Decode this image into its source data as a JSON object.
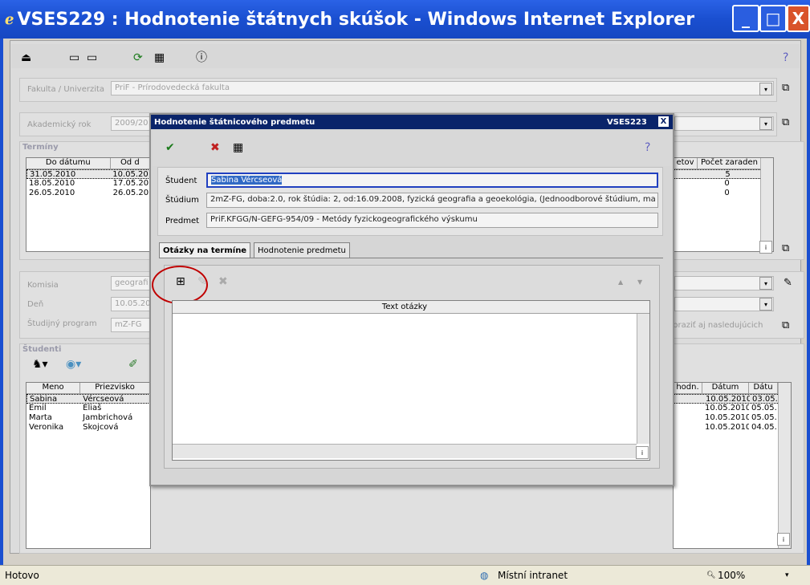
{
  "window": {
    "title": "VSES229 : Hodnotenie štátnych skúšok - Windows Internet Explorer",
    "minimize": "_",
    "maximize": "□",
    "close": "X"
  },
  "main": {
    "faculty_label": "Fakulta / Univerzita",
    "faculty_value": "PriF - Prírodovedecká fakulta",
    "year_label": "Akademický rok",
    "year_value": "2009/20",
    "terms_section": "Termíny",
    "terms_headers": [
      "Do dátumu",
      "Od d"
    ],
    "terms_rows": [
      [
        "31.05.2010",
        "10.05.20"
      ],
      [
        "18.05.2010",
        "17.05.20"
      ],
      [
        "26.05.2010",
        "26.05.20"
      ]
    ],
    "terms_right_headers": [
      "etov",
      "Počet zaraden"
    ],
    "terms_right_values": [
      "5",
      "0",
      "0"
    ],
    "commission_label": "Komisia",
    "commission_value": "geografi",
    "day_label": "Deň",
    "day_value": "10.05.20",
    "program_label": "Študijný program",
    "program_value": "mZ-FG",
    "show_next": "obraziť aj nasledujúcich",
    "students_section": "Študenti",
    "students_headers": [
      "Meno",
      "Priezvisko"
    ],
    "students_rows": [
      [
        "Sabina",
        "Vércseová"
      ],
      [
        "Emil",
        "Eliaš"
      ],
      [
        "Marta",
        "Jambrichová"
      ],
      [
        "Veronika",
        "Škojcová"
      ]
    ],
    "students_right_headers": [
      "hodn.",
      "Dátum",
      "Dátu"
    ],
    "students_right_rows": [
      [
        "10.05.2010",
        "03.05."
      ],
      [
        "10.05.2010",
        "05.05."
      ],
      [
        "10.05.2010",
        "05.05."
      ],
      [
        "10.05.2010",
        "04.05."
      ]
    ],
    "info_btn": "i"
  },
  "dialog": {
    "title": "Hodnotenie štátnicového predmetu",
    "code": "VSES223",
    "close": "X",
    "student_label": "Študent",
    "student_value": "Sabina Vércseová",
    "study_label": "Štúdium",
    "study_value": "2mZ-FG, doba:2.0, rok štúdia: 2, od:16.09.2008, fyzická geografia a geoekológia, (Jednoodborové štúdium, ma",
    "subject_label": "Predmet",
    "subject_value": "PriF.KFGG/N-GEFG-954/09 - Metódy fyzickogeografického výskumu",
    "tab1": "Otázky na termíne",
    "tab2": "Hodnotenie predmetu",
    "grid_header": "Text otázky",
    "info_btn": "i"
  },
  "status": {
    "left": "Hotovo",
    "zone": "Místní intranet",
    "zoom": "100%"
  }
}
